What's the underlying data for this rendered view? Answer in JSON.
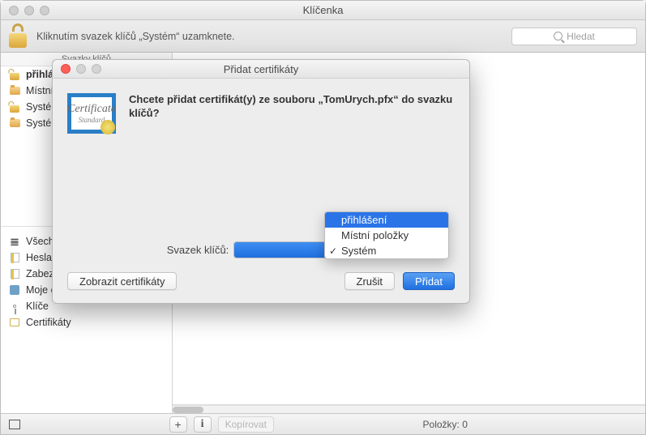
{
  "window": {
    "title": "Klíčenka",
    "toolbar_message": "Kliknutím svazek klíčů „Systém“ uzamknete.",
    "search_placeholder": "Hledat"
  },
  "sidebar": {
    "keychains_header": "Svazky klíčů",
    "keychains": [
      {
        "label": "přihlášení",
        "icon": "lock-open",
        "bold": true
      },
      {
        "label": "Místní položky",
        "icon": "folder"
      },
      {
        "label": "Systém",
        "icon": "lock-open"
      },
      {
        "label": "Systémové kořeny",
        "icon": "folder"
      }
    ],
    "categories": [
      {
        "label": "Všechny položky",
        "icon": "compass"
      },
      {
        "label": "Hesla",
        "icon": "note"
      },
      {
        "label": "Zabezpečené poznámky",
        "icon": "note"
      },
      {
        "label": "Moje certifikáty",
        "icon": "puzzle"
      },
      {
        "label": "Klíče",
        "icon": "key"
      },
      {
        "label": "Certifikáty",
        "icon": "cert"
      }
    ]
  },
  "status": {
    "copy": "Kopírovat",
    "items": "Položky: 0"
  },
  "dialog": {
    "title": "Přidat certifikáty",
    "message": "Chcete přidat certifikát(y) ze souboru „TomUrych.pfx“ do svazku klíčů?",
    "keychain_label": "Svazek klíčů:",
    "show_certs": "Zobrazit certifikáty",
    "cancel": "Zrušit",
    "add": "Přidat",
    "dropdown": {
      "options": [
        {
          "label": "přihlášení",
          "highlighted": true,
          "checked": false
        },
        {
          "label": "Místní položky",
          "highlighted": false,
          "checked": false
        },
        {
          "label": "Systém",
          "highlighted": false,
          "checked": true
        }
      ]
    }
  }
}
